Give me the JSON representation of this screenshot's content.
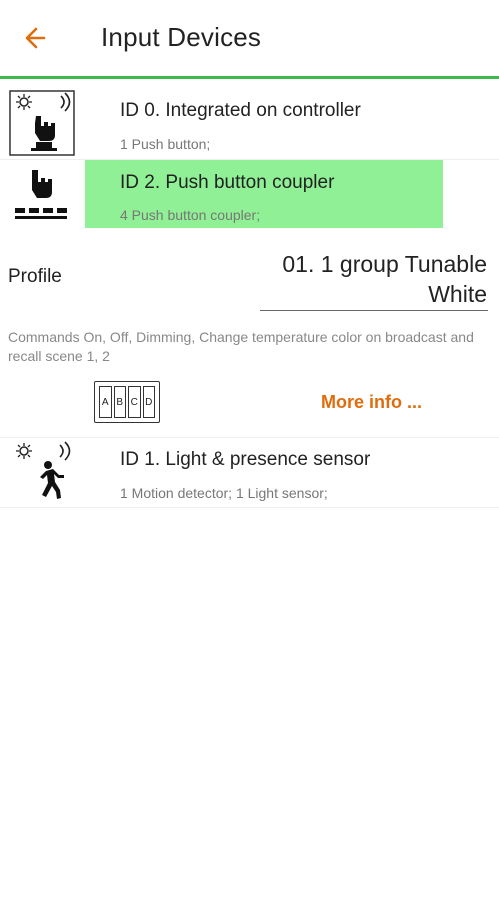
{
  "header": {
    "title": "Input Devices",
    "accent_color": "#e06c0c",
    "divider_color": "#3dba4b"
  },
  "devices": [
    {
      "name": "ID 0. Integrated on controller",
      "detail": "1 Push button;",
      "icon": "push-button-sensor-icon"
    },
    {
      "name": "ID 2. Push button coupler",
      "detail": "4 Push button coupler;",
      "icon": "push-button-coupler-icon",
      "highlight_color": "#8ff095"
    },
    {
      "name": "ID 1. Light & presence sensor",
      "detail": "1 Motion detector; 1 Light sensor;",
      "icon": "presence-sensor-icon"
    }
  ],
  "profile": {
    "label": "Profile",
    "value": "01. 1 group Tunable White",
    "description": "Commands On, Off, Dimming, Change temperature color on broadcast and recall scene 1, 2",
    "button_letters": [
      "A",
      "B",
      "C",
      "D"
    ],
    "more_info": "More info ..."
  }
}
